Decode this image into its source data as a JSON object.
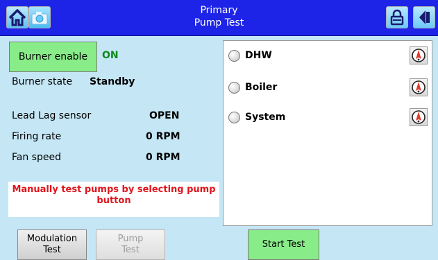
{
  "header": {
    "title_line1": "Primary",
    "title_line2": "Pump Test",
    "icons": [
      "home-icon",
      "camera-icon",
      "lock-icon",
      "back-icon"
    ]
  },
  "burner": {
    "enable_label": "Burner enable",
    "enable_status": "ON",
    "state_label": "Burner state",
    "state_value": "Standby"
  },
  "readings": {
    "lead_lag_label": "Lead Lag sensor",
    "lead_lag_value": "OPEN",
    "firing_rate_label": "Firing rate",
    "firing_rate_value": "0 RPM",
    "fan_speed_label": "Fan speed",
    "fan_speed_value": "0 RPM"
  },
  "note": {
    "line1": "Manually test pumps by selecting pump",
    "line2": "button"
  },
  "pumps": [
    {
      "label": "DHW",
      "selected": false,
      "icon": "pump-gauge-icon"
    },
    {
      "label": "Boiler",
      "selected": false,
      "icon": "pump-gauge-icon"
    },
    {
      "label": "System",
      "selected": false,
      "icon": "pump-gauge-icon"
    }
  ],
  "tabs": {
    "modulation_line1": "Modulation",
    "modulation_line2": "Test",
    "pump_line1": "Pump",
    "pump_line2": "Test"
  },
  "actions": {
    "start_label": "Start Test"
  },
  "colors": {
    "header_bg": "#1d24e8",
    "page_bg": "#c5e6f5",
    "button_green": "#88ec88",
    "status_on": "#0b8a1a",
    "note_text": "#e0141b"
  }
}
